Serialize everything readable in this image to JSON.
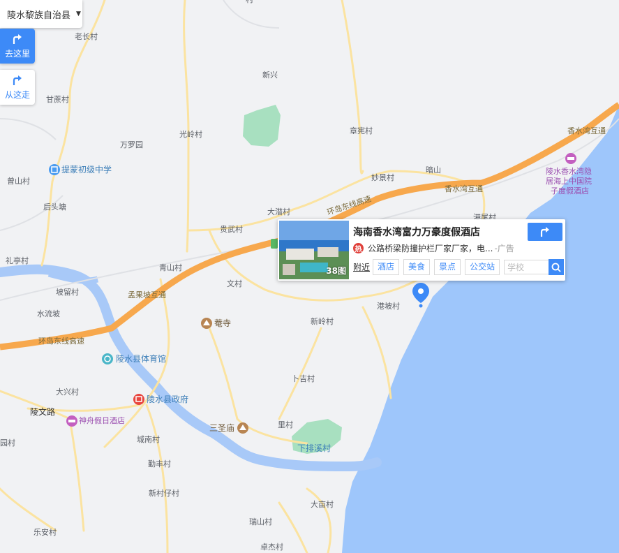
{
  "region": {
    "name": "陵水黎族自治县"
  },
  "nav": {
    "to_here": "去这里",
    "from_here": "从这走"
  },
  "colors": {
    "accent": "#3d8af7",
    "sea": "#9ec6fb",
    "river": "#a8c9f8",
    "highway": "#f7a84d",
    "green": "#a8e0c0"
  },
  "popup": {
    "title": "海南香水湾富力万豪度假酒店",
    "photo_count": "38图",
    "hot_icon": "热",
    "ad_text": "公路桥梁防撞护栏厂家厂家，电...",
    "ad_tag": "-广告",
    "nearby": "附近",
    "chips": [
      "酒店",
      "美食",
      "景点",
      "公交站"
    ],
    "search_placeholder": "学校"
  },
  "places": {
    "laochang": "老长村",
    "xinxing": "新兴",
    "ganzhe": "甘蔗村",
    "guangling": "光岭村",
    "zhangtu": "章宪村",
    "wanluyuan": "万罗园",
    "timeng": "提蒙初级中学",
    "zengshan": "曾山村",
    "houtou": "后头塘",
    "miaojing": "妙景村",
    "anshan": "暗山",
    "xiangshuiwan_ic": "香水湾互通",
    "xiangshuiwan_top": "香水湾互通",
    "datan": "大潜村",
    "guiwu": "贵武村",
    "lishou": "礼亭村",
    "qingshan": "青山村",
    "wencun": "文村",
    "pojing": "坡留村",
    "shuiliu": "水流坡",
    "mengguo": "孟果坡互通",
    "xinling": "新岭村",
    "gangpo": "港坡村",
    "gangpo2": "港尾村",
    "ansi": "菴寺",
    "gymnasium": "陵水县体育馆",
    "huandao": "环岛东线高速",
    "huandao2": "环岛东线高速",
    "daxing": "大兴村",
    "government": "陵水县政府",
    "shangji": "卜吉村",
    "lingwen": "陵文路",
    "shenzhou": "神舟假日酒店",
    "sansheng": "三圣庙",
    "licun": "里村",
    "chengnan": "城南村",
    "xiapai": "下排溪村",
    "yuan": "园村",
    "dingfeng": "勤丰村",
    "xincunzai": "新村仔村",
    "damiao": "大亩村",
    "ruishan": "瑞山村",
    "lean": "乐安村",
    "zhuojie": "卓杰村",
    "hotel_xs_1": "陵水香水湾隐",
    "hotel_xs_2": "居海上中国院",
    "hotel_xs_3": "子度假酒店",
    "top_cut": "村"
  }
}
